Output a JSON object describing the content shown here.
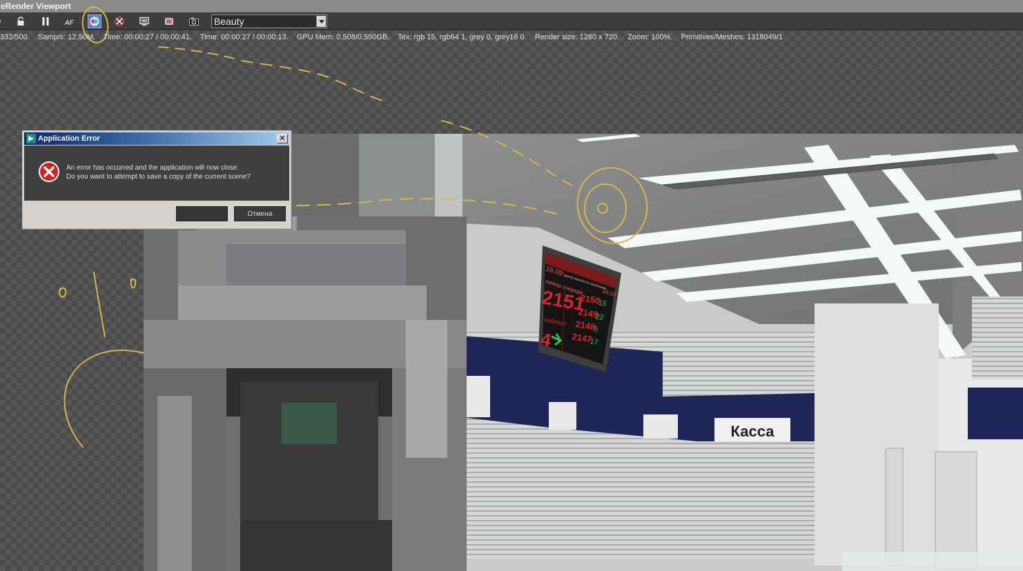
{
  "window": {
    "title": "eRender Viewport"
  },
  "toolbar": {
    "render_pass": "Beauty",
    "buttons": [
      {
        "name": "back-icon"
      },
      {
        "name": "lock-icon"
      },
      {
        "name": "pause-icon"
      },
      {
        "name": "af-icon",
        "label": "AF"
      },
      {
        "name": "color-picker-icon",
        "active": true
      },
      {
        "name": "clear-marker-icon"
      },
      {
        "name": "display-icon"
      },
      {
        "name": "film-icon"
      },
      {
        "name": "camera-icon"
      }
    ]
  },
  "stats": {
    "samples": "332/500.",
    "samples_per_sec": "Samp/s: 12,50M.",
    "time_total": "Time: 00:00:27 / 00:00:41.",
    "time_current": "Time: 00:00:27 / 00:00:13.",
    "gpu_mem": "GPU Mem: 0,508/0,550GB.",
    "tex": "Tex: rgb 15, rgb64 1, grey 0, grey16 0.",
    "render_size": "Render size: 1280 x 720.",
    "zoom": "Zoom: 100%.",
    "primitives": "Primitives/Meshes: 1318049/1"
  },
  "dialog": {
    "title": "Application Error",
    "close_glyph": "✕",
    "message_line1": "An error has occurred and the application will now close.",
    "message_line2": "Do you want to attempt to save a copy of the current scene?",
    "ok_label": "",
    "cancel_label": "Отмена"
  },
  "scene": {
    "board": {
      "date": "16.09",
      "header": "Центр занятости населения",
      "time": "16:03",
      "subheader": "номер очереди",
      "current_number": "2151",
      "cabinet_label": "кабинет",
      "cabinet_number": "4",
      "queue": [
        {
          "number": "2150",
          "window": "15"
        },
        {
          "number": "2149",
          "window": "22"
        },
        {
          "number": "2148",
          "window": "5"
        },
        {
          "number": "2147",
          "window": "17"
        }
      ]
    },
    "kassa_sign": "Касса"
  },
  "colors": {
    "board_red": "#d8242a",
    "board_green": "#2fc24a",
    "navy_band": "#1f2556",
    "annotation": "#d9b54a",
    "active_button": "#5a7fc4"
  }
}
